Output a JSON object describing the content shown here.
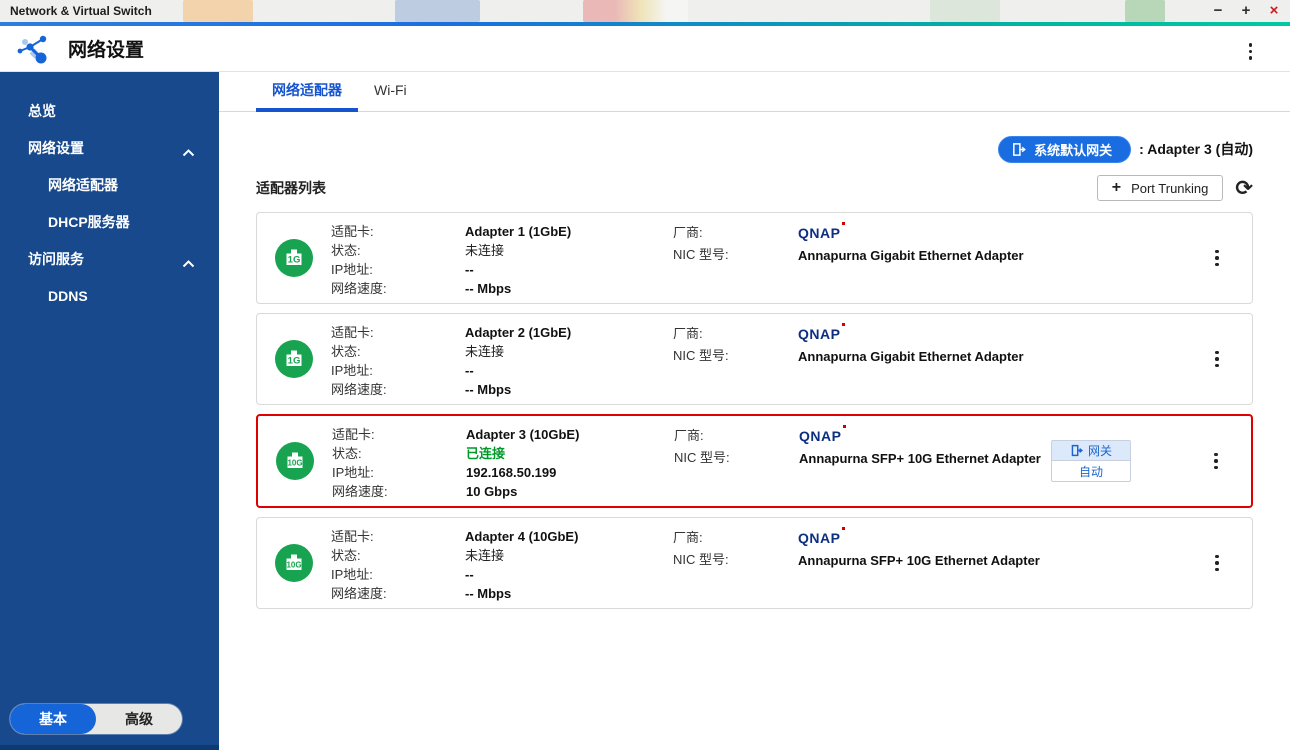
{
  "window": {
    "title": "Network & Virtual Switch",
    "controls": {
      "minimize": "−",
      "maximize": "+",
      "close": "×"
    }
  },
  "header": {
    "title": "网络设置"
  },
  "sidebar": {
    "items": [
      {
        "label": "总览",
        "level": 0,
        "expandable": false
      },
      {
        "label": "网络设置",
        "level": 0,
        "expandable": true
      },
      {
        "label": "网络适配器",
        "level": 1,
        "expandable": false
      },
      {
        "label": "DHCP服务器",
        "level": 1,
        "expandable": false
      },
      {
        "label": "访问服务",
        "level": 0,
        "expandable": true
      },
      {
        "label": "DDNS",
        "level": 1,
        "expandable": false
      }
    ],
    "mode_toggle": {
      "basic": "基本",
      "advanced": "高级",
      "selected": "基本"
    }
  },
  "main": {
    "tabs": [
      {
        "label": "网络适配器",
        "active": true
      },
      {
        "label": "Wi-Fi",
        "active": false
      }
    ],
    "gateway": {
      "button_label": "系统默认网关",
      "value": ": Adapter 3 (自动)"
    },
    "list_title": "适配器列表",
    "port_trunking_label": "Port Trunking",
    "field_labels": {
      "adapter": "适配卡:",
      "status": "状态:",
      "ip": "IP地址:",
      "speed": "网络速度:",
      "vendor": "厂商:",
      "nic": "NIC 型号:"
    },
    "adapters": [
      {
        "badge": "1G",
        "name": "Adapter 1 (1GbE)",
        "status": "未连接",
        "connected": false,
        "ip": "--",
        "speed": "-- Mbps",
        "vendor": "QNAP",
        "model": "Annapurna Gigabit Ethernet Adapter",
        "selected": false
      },
      {
        "badge": "1G",
        "name": "Adapter 2 (1GbE)",
        "status": "未连接",
        "connected": false,
        "ip": "--",
        "speed": "-- Mbps",
        "vendor": "QNAP",
        "model": "Annapurna Gigabit Ethernet Adapter",
        "selected": false
      },
      {
        "badge": "10G",
        "name": "Adapter 3 (10GbE)",
        "status": "已连接",
        "connected": true,
        "ip": "192.168.50.199",
        "speed": "10 Gbps",
        "vendor": "QNAP",
        "model": "Annapurna SFP+ 10G Ethernet Adapter",
        "selected": true,
        "tags": {
          "gateway": "网关",
          "auto": "自动"
        }
      },
      {
        "badge": "10G",
        "name": "Adapter 4 (10GbE)",
        "status": "未连接",
        "connected": false,
        "ip": "--",
        "speed": "-- Mbps",
        "vendor": "QNAP",
        "model": "Annapurna SFP+ 10G Ethernet Adapter",
        "selected": false
      }
    ]
  },
  "icons": {
    "plus": "+",
    "refresh": "⟳"
  },
  "colors": {
    "sidebar_blue": "#17498C",
    "accent_blue": "#1565D8",
    "tab_active_blue": "#1553CF",
    "gateway_button_blue": "#1A6DE0",
    "selected_border_red": "#E00000",
    "connected_green": "#009A2B",
    "adapter_icon_green": "#17A34F",
    "qnap_navy": "#0D2F80",
    "tag_blue": "#1B66CC",
    "gradient_left": "#2E7CE0",
    "gradient_right": "#00C9A4"
  }
}
